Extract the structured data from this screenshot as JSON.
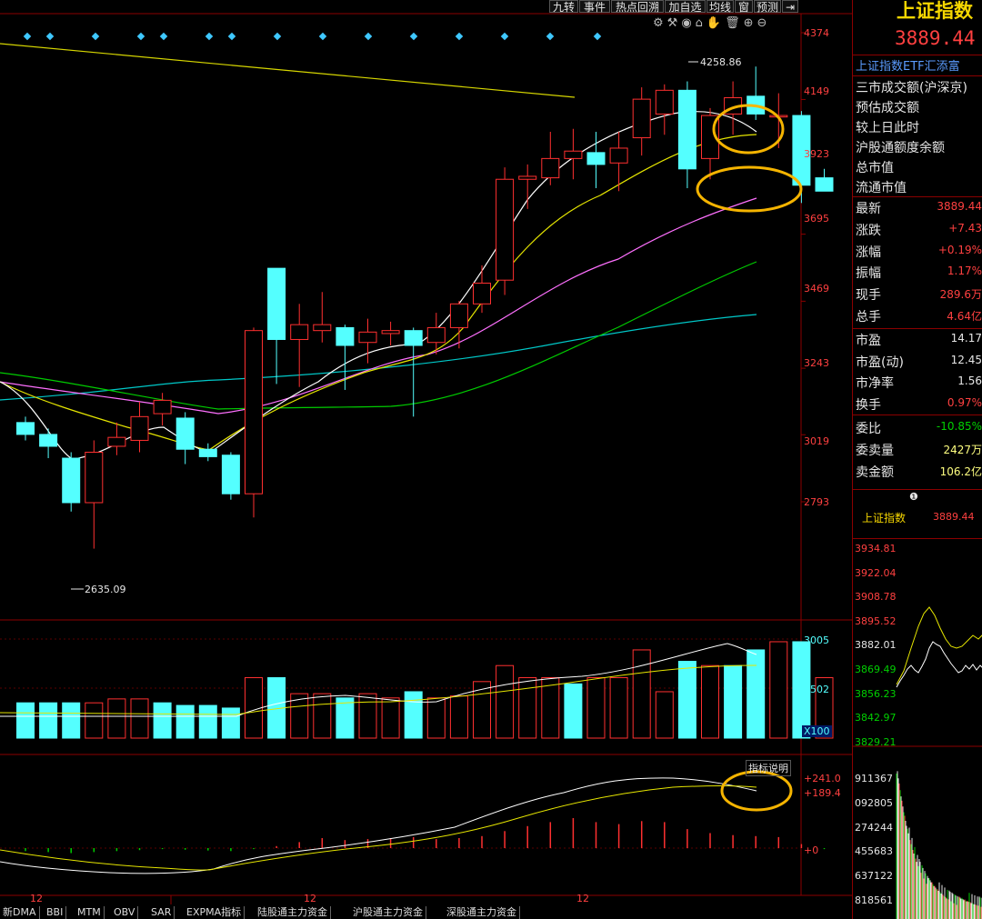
{
  "toolbar": {
    "buttons": [
      "九转",
      "事件",
      "热点回溯",
      "加自选",
      "均线",
      "窗",
      "预测"
    ]
  },
  "price_axis": [
    "4374",
    "4149",
    "3923",
    "3695",
    "3469",
    "3243",
    "3019",
    "2793"
  ],
  "volume_axis": [
    "3005",
    "1502",
    "X100"
  ],
  "macd_axis": [
    "+241.0",
    "+189.4",
    "+0"
  ],
  "macd_help": "指标说明",
  "time_labels": [
    "12",
    "12",
    "12"
  ],
  "annotations": {
    "high": "4258.86",
    "low": "2635.09"
  },
  "bottom_tabs": [
    "新DMA",
    "BBI",
    "MTM",
    "OBV",
    "SAR",
    "EXPMA指标",
    "陆股通主力资金",
    "沪股通主力资金",
    "深股通主力资金"
  ],
  "quote": {
    "title": "上证指数",
    "price": "3889.44",
    "etf_label": "上证指数ETF汇添富",
    "info_rows": [
      "三市成交额(沪深京)",
      "预估成交额",
      "较上日此时",
      "沪股通额度余额",
      "总市值",
      "流通市值"
    ],
    "stats": [
      {
        "label": "最新",
        "value": "3889.44"
      },
      {
        "label": "涨跌",
        "value": "+7.43"
      },
      {
        "label": "涨幅",
        "value": "+0.19%"
      },
      {
        "label": "振幅",
        "value": "1.17%"
      },
      {
        "label": "现手",
        "value": "289.6万"
      },
      {
        "label": "总手",
        "value": "4.64亿"
      },
      {
        "label": "市盈",
        "value": "14.17"
      },
      {
        "label": "市盈(动)",
        "value": "12.45"
      },
      {
        "label": "市净率",
        "value": "1.56"
      },
      {
        "label": "换手",
        "value": "0.97%"
      },
      {
        "label": "委比",
        "value": "-10.85%"
      },
      {
        "label": "委卖量",
        "value": "2427万"
      },
      {
        "label": "卖金额",
        "value": "106.2亿"
      }
    ],
    "mini_title": "上证指数",
    "mini_value": "3889.44",
    "intraday_axis": [
      "3934.81",
      "3922.04",
      "3908.78",
      "3895.52",
      "3882.01",
      "3869.49",
      "3856.23",
      "3842.97",
      "3829.21"
    ],
    "intraday_vol_axis": [
      "911367",
      "092805",
      "274244",
      "455683",
      "637122",
      "818561"
    ]
  },
  "colors": {
    "up": "#ff3030",
    "down": "#54ffff",
    "ma5": "#ffffff",
    "ma10": "#e5e500",
    "ma20": "#ff70ff",
    "ma30": "#00cc00",
    "ma60": "#00c8c8",
    "highlight": "#f5b400"
  },
  "chart_data": {
    "type": "candlestick",
    "price_range": [
      2635,
      4374
    ],
    "candles": [
      {
        "o": 3060,
        "h": 3080,
        "l": 3000,
        "c": 3020
      },
      {
        "o": 3020,
        "h": 3040,
        "l": 2940,
        "c": 2980
      },
      {
        "o": 2940,
        "h": 2960,
        "l": 2760,
        "c": 2790
      },
      {
        "o": 2790,
        "h": 3000,
        "l": 2635,
        "c": 2960
      },
      {
        "o": 2980,
        "h": 3060,
        "l": 2950,
        "c": 3010
      },
      {
        "o": 3000,
        "h": 3130,
        "l": 2960,
        "c": 3080
      },
      {
        "o": 3090,
        "h": 3160,
        "l": 3050,
        "c": 3135
      },
      {
        "o": 3075,
        "h": 3095,
        "l": 2920,
        "c": 2970
      },
      {
        "o": 2970,
        "h": 2990,
        "l": 2930,
        "c": 2945
      },
      {
        "o": 2950,
        "h": 2960,
        "l": 2800,
        "c": 2820
      },
      {
        "o": 2820,
        "h": 3380,
        "l": 2740,
        "c": 3370
      },
      {
        "o": 3580,
        "h": 3580,
        "l": 3190,
        "c": 3340
      },
      {
        "o": 3340,
        "h": 3460,
        "l": 3180,
        "c": 3390
      },
      {
        "o": 3370,
        "h": 3500,
        "l": 3330,
        "c": 3390
      },
      {
        "o": 3380,
        "h": 3390,
        "l": 3170,
        "c": 3320
      },
      {
        "o": 3330,
        "h": 3410,
        "l": 3260,
        "c": 3365
      },
      {
        "o": 3360,
        "h": 3400,
        "l": 3320,
        "c": 3370
      },
      {
        "o": 3370,
        "h": 3380,
        "l": 3080,
        "c": 3320
      },
      {
        "o": 3330,
        "h": 3430,
        "l": 3290,
        "c": 3380
      },
      {
        "o": 3380,
        "h": 3470,
        "l": 3310,
        "c": 3460
      },
      {
        "o": 3460,
        "h": 3590,
        "l": 3430,
        "c": 3530
      },
      {
        "o": 3540,
        "h": 3920,
        "l": 3490,
        "c": 3880
      },
      {
        "o": 3880,
        "h": 3930,
        "l": 3780,
        "c": 3890
      },
      {
        "o": 3885,
        "h": 4040,
        "l": 3860,
        "c": 3950
      },
      {
        "o": 3950,
        "h": 4050,
        "l": 3880,
        "c": 3975
      },
      {
        "o": 3970,
        "h": 4040,
        "l": 3850,
        "c": 3930
      },
      {
        "o": 3935,
        "h": 4040,
        "l": 3840,
        "c": 3985
      },
      {
        "o": 4020,
        "h": 4190,
        "l": 3960,
        "c": 4150
      },
      {
        "o": 4100,
        "h": 4200,
        "l": 4030,
        "c": 4180
      },
      {
        "o": 4180,
        "h": 4210,
        "l": 3850,
        "c": 3915
      },
      {
        "o": 3950,
        "h": 4120,
        "l": 3880,
        "c": 4095
      },
      {
        "o": 4100,
        "h": 4210,
        "l": 4030,
        "c": 4155
      },
      {
        "o": 4160,
        "h": 4260,
        "l": 4080,
        "c": 4100
      },
      {
        "o": 4090,
        "h": 4170,
        "l": 3985,
        "c": 4095
      },
      {
        "o": 4095,
        "h": 4110,
        "l": 3800,
        "c": 3860
      },
      {
        "o": 3885,
        "h": 3915,
        "l": 3840,
        "c": 3840
      }
    ],
    "volume": [
      {
        "v": 1080,
        "up": false
      },
      {
        "v": 1080,
        "up": false
      },
      {
        "v": 1080,
        "up": false
      },
      {
        "v": 1080,
        "up": true
      },
      {
        "v": 1200,
        "up": true
      },
      {
        "v": 1200,
        "up": true
      },
      {
        "v": 1080,
        "up": false
      },
      {
        "v": 1000,
        "up": false
      },
      {
        "v": 1000,
        "up": false
      },
      {
        "v": 920,
        "up": false
      },
      {
        "v": 1850,
        "up": true
      },
      {
        "v": 1850,
        "up": false
      },
      {
        "v": 1360,
        "up": true
      },
      {
        "v": 1360,
        "up": true
      },
      {
        "v": 1230,
        "up": false
      },
      {
        "v": 1360,
        "up": true
      },
      {
        "v": 1230,
        "up": true
      },
      {
        "v": 1420,
        "up": false
      },
      {
        "v": 1230,
        "up": true
      },
      {
        "v": 1290,
        "up": true
      },
      {
        "v": 1730,
        "up": true
      },
      {
        "v": 2220,
        "up": true
      },
      {
        "v": 1850,
        "up": true
      },
      {
        "v": 1850,
        "up": true
      },
      {
        "v": 1660,
        "up": false
      },
      {
        "v": 1850,
        "up": true
      },
      {
        "v": 1850,
        "up": true
      },
      {
        "v": 2700,
        "up": true
      },
      {
        "v": 1420,
        "up": true
      },
      {
        "v": 2350,
        "up": false
      },
      {
        "v": 2220,
        "up": true
      },
      {
        "v": 2220,
        "up": false
      },
      {
        "v": 2700,
        "up": false
      },
      {
        "v": 2950,
        "up": true
      },
      {
        "v": 2950,
        "up": false
      },
      {
        "v": 1850,
        "up": true
      }
    ],
    "macd": [
      -15,
      -20,
      -25,
      -20,
      -15,
      -10,
      -5,
      -8,
      -12,
      -15,
      -5,
      10,
      30,
      50,
      40,
      45,
      50,
      55,
      45,
      50,
      60,
      85,
      110,
      130,
      150,
      130,
      120,
      135,
      130,
      95,
      75,
      65,
      60,
      55,
      20,
      -5
    ]
  }
}
